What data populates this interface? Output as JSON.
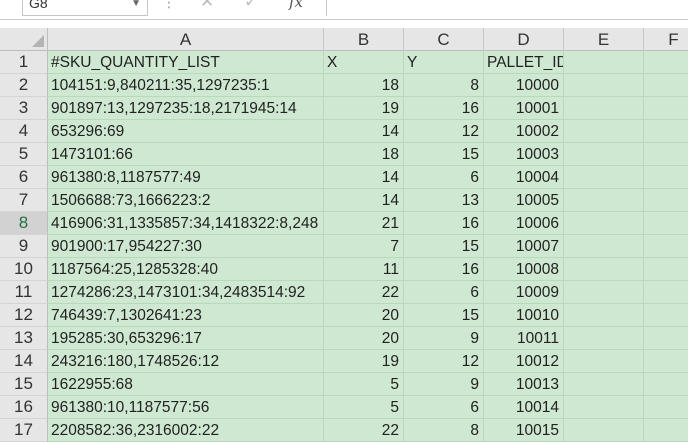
{
  "name_box": {
    "value": "G8"
  },
  "formula_bar": {
    "dots": "⋮",
    "cancel_glyph": "✕",
    "enter_glyph": "✓",
    "fx_label": "fx",
    "value": ""
  },
  "columns": [
    "A",
    "B",
    "C",
    "D",
    "E",
    "F"
  ],
  "header_row": {
    "num": "1",
    "a": "#SKU_QUANTITY_LIST",
    "b": "X",
    "c": "Y",
    "d": "PALLET_ID",
    "e": "",
    "f": ""
  },
  "selected_row": "8",
  "rows": [
    {
      "num": "2",
      "a": "104151:9,840211:35,1297235:1",
      "b": "18",
      "c": "8",
      "d": "10000"
    },
    {
      "num": "3",
      "a": "901897:13,1297235:18,2171945:14",
      "b": "19",
      "c": "16",
      "d": "10001"
    },
    {
      "num": "4",
      "a": "653296:69",
      "b": "14",
      "c": "12",
      "d": "10002"
    },
    {
      "num": "5",
      "a": "1473101:66",
      "b": "18",
      "c": "15",
      "d": "10003"
    },
    {
      "num": "6",
      "a": "961380:8,1187577:49",
      "b": "14",
      "c": "6",
      "d": "10004"
    },
    {
      "num": "7",
      "a": "1506688:73,1666223:2",
      "b": "14",
      "c": "13",
      "d": "10005"
    },
    {
      "num": "8",
      "a": "416906:31,1335857:34,1418322:8,248",
      "b": "21",
      "c": "16",
      "d": "10006"
    },
    {
      "num": "9",
      "a": "901900:17,954227:30",
      "b": "7",
      "c": "15",
      "d": "10007"
    },
    {
      "num": "10",
      "a": "1187564:25,1285328:40",
      "b": "11",
      "c": "16",
      "d": "10008"
    },
    {
      "num": "11",
      "a": "1274286:23,1473101:34,2483514:92",
      "b": "22",
      "c": "6",
      "d": "10009"
    },
    {
      "num": "12",
      "a": "746439:7,1302641:23",
      "b": "20",
      "c": "15",
      "d": "10010"
    },
    {
      "num": "13",
      "a": "195285:30,653296:17",
      "b": "20",
      "c": "9",
      "d": "10011"
    },
    {
      "num": "14",
      "a": "243216:180,1748526:12",
      "b": "19",
      "c": "12",
      "d": "10012"
    },
    {
      "num": "15",
      "a": "1622955:68",
      "b": "5",
      "c": "9",
      "d": "10013"
    },
    {
      "num": "16",
      "a": "961380:10,1187577:56",
      "b": "5",
      "c": "6",
      "d": "10014"
    },
    {
      "num": "17",
      "a": "2208582:36,2316002:22",
      "b": "22",
      "c": "8",
      "d": "10015"
    }
  ]
}
